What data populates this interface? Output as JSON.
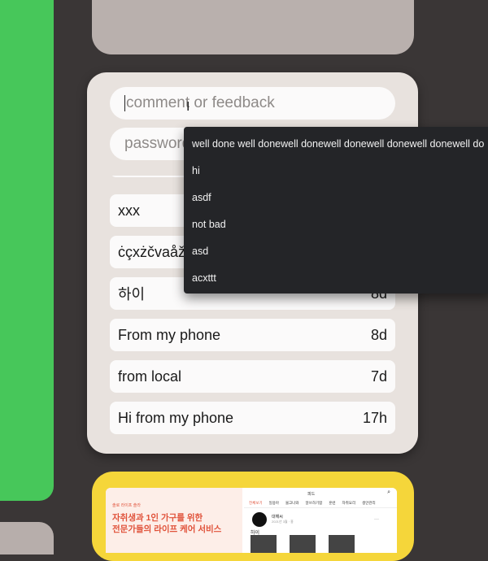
{
  "colors": {
    "background": "#3a3636",
    "green_panel": "#47c75a",
    "card": "#e8e2de",
    "top_card": "#b9b0ad",
    "yellow_card": "#f5d63a",
    "autocomplete_bg": "#242528"
  },
  "form": {
    "comment_placeholder": "comment or feedback",
    "password_placeholder": "password"
  },
  "autocomplete": {
    "items": [
      "well done well donewell donewell donewell donewell donewell do",
      "hi",
      "asdf",
      "not bad",
      "asd",
      "acxttt"
    ]
  },
  "messages": [
    {
      "text": "xxx",
      "age": ""
    },
    {
      "text": "ċçxżčvaåž",
      "age": ""
    },
    {
      "text": "하이",
      "age": "8d"
    },
    {
      "text": "From my phone",
      "age": "8d"
    },
    {
      "text": "from local",
      "age": "7d"
    },
    {
      "text": "Hi from my phone",
      "age": "17h"
    }
  ],
  "thumbnail": {
    "small_label": "솔로 라이프 솔라",
    "headline_1": "자취생과 1인 가구를 위한",
    "headline_2": "전문가들의 라이프 케어 서비스",
    "right_title": "피드",
    "tabs": [
      "전체보기",
      "일용아",
      "물고나와",
      "알쓰하기합",
      "훈련",
      "자취요리",
      "생안관리"
    ],
    "post_name": "대해씨",
    "post_sub": "2021년 3월 · 홍",
    "post_text": "하이",
    "more": "···",
    "search_icon": "search-icon"
  }
}
